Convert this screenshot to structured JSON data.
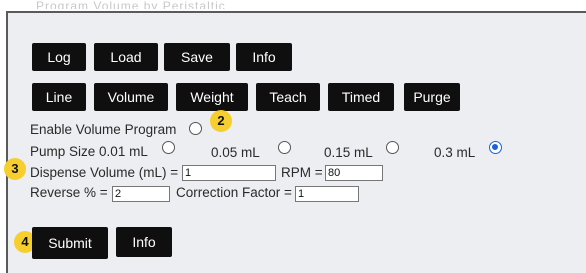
{
  "header_partial": "Program Volume by Peristaltic",
  "row1": {
    "log": "Log",
    "load": "Load",
    "save": "Save",
    "info": "Info"
  },
  "row2": {
    "line": "Line",
    "volume": "Volume",
    "weight": "Weight",
    "teach": "Teach",
    "timed": "Timed",
    "purge": "Purge"
  },
  "enable_volume_program": "Enable Volume Program",
  "pump_size": {
    "label": "Pump Size",
    "options": [
      "0.01 mL",
      "0.05 mL",
      "0.15 mL",
      "0.3 mL"
    ],
    "selected": "0.3 mL"
  },
  "dispense": {
    "label": "Dispense Volume (mL) =",
    "value": "1"
  },
  "rpm": {
    "label": "RPM =",
    "value": "80"
  },
  "reverse": {
    "label": "Reverse % =",
    "value": "2"
  },
  "correction": {
    "label": "Correction Factor =",
    "value": "1"
  },
  "bottom": {
    "submit": "Submit",
    "info": "Info"
  },
  "badges": {
    "b2": "2",
    "b3": "3",
    "b4": "4"
  },
  "colors": {
    "badge": "#f6cf2e",
    "button": "#0f0f0f",
    "radio_selected": "#1a63d6",
    "panel": "#eceef1"
  }
}
